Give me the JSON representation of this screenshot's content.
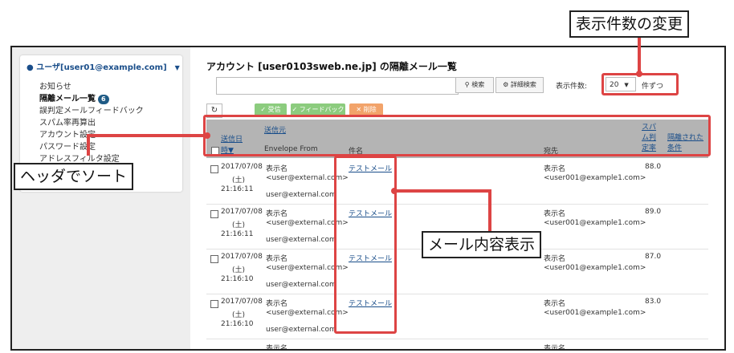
{
  "sidebar": {
    "user_label": "ユーザ[user01@example.com]",
    "items": [
      {
        "label": "お知らせ"
      },
      {
        "label": "隔離メール一覧",
        "badge": "6"
      },
      {
        "label": "誤判定メールフィードバック"
      },
      {
        "label": "スパム率再算出"
      },
      {
        "label": "アカウント設定"
      },
      {
        "label": "パスワード設定"
      },
      {
        "label": "アドレスフィルタ設定"
      }
    ]
  },
  "main": {
    "title": "アカウント [user0103sweb.ne.jp] の隔離メール一覧",
    "search_placeholder": "",
    "search_button": "検索",
    "advanced_search_button": "詳細検索",
    "count_label": "表示件数:",
    "count_value": "20",
    "count_suffix": "件ずつ",
    "actions": {
      "receive": "受信",
      "feedback": "フィードバック",
      "delete": "削除"
    }
  },
  "table": {
    "headers": {
      "date": "送信日時▼",
      "sender": "送信元",
      "envelope_from": "Envelope From",
      "subject": "件名",
      "recipient": "宛先",
      "spam_rate": "スパム判定率",
      "quarantine_condition": "隔離された条件"
    },
    "rows": [
      {
        "date": "2017/07/08",
        "day": "(土)",
        "time": "21:16:11",
        "sender_name": "表示名",
        "sender_addr": "<user@external.com>",
        "envelope_from": "user@external.com",
        "subject": "テストメール",
        "recipient_name": "表示名",
        "recipient_addr": "<user001@example1.com>",
        "spam_rate": "88.0"
      },
      {
        "date": "2017/07/08",
        "day": "(土)",
        "time": "21:16:11",
        "sender_name": "表示名",
        "sender_addr": "<user@external.com>",
        "envelope_from": "user@external.com",
        "subject": "テストメール",
        "recipient_name": "表示名",
        "recipient_addr": "<user001@example1.com>",
        "spam_rate": "89.0"
      },
      {
        "date": "2017/07/08",
        "day": "(土)",
        "time": "21:16:10",
        "sender_name": "表示名",
        "sender_addr": "<user@external.com>",
        "envelope_from": "user@external.com",
        "subject": "テストメール",
        "recipient_name": "表示名",
        "recipient_addr": "<user001@example1.com>",
        "spam_rate": "87.0"
      },
      {
        "date": "2017/07/08",
        "day": "(土)",
        "time": "21:16:10",
        "sender_name": "表示名",
        "sender_addr": "<user@external.com>",
        "envelope_from": "user@external.com",
        "subject": "テストメール",
        "recipient_name": "表示名",
        "recipient_addr": "<user001@example1.com>",
        "spam_rate": "83.0"
      }
    ],
    "partial_row": {
      "sender_name": "表示名",
      "recipient_name": "表示名"
    }
  },
  "annotations": {
    "count_change": "表示件数の変更",
    "header_sort": "ヘッダでソート",
    "mail_content": "メール内容表示"
  },
  "colors": {
    "accent": "#dd4444",
    "header_bg": "#b4b4b4",
    "link": "#1a4e8a",
    "badge": "#1e5a85"
  }
}
